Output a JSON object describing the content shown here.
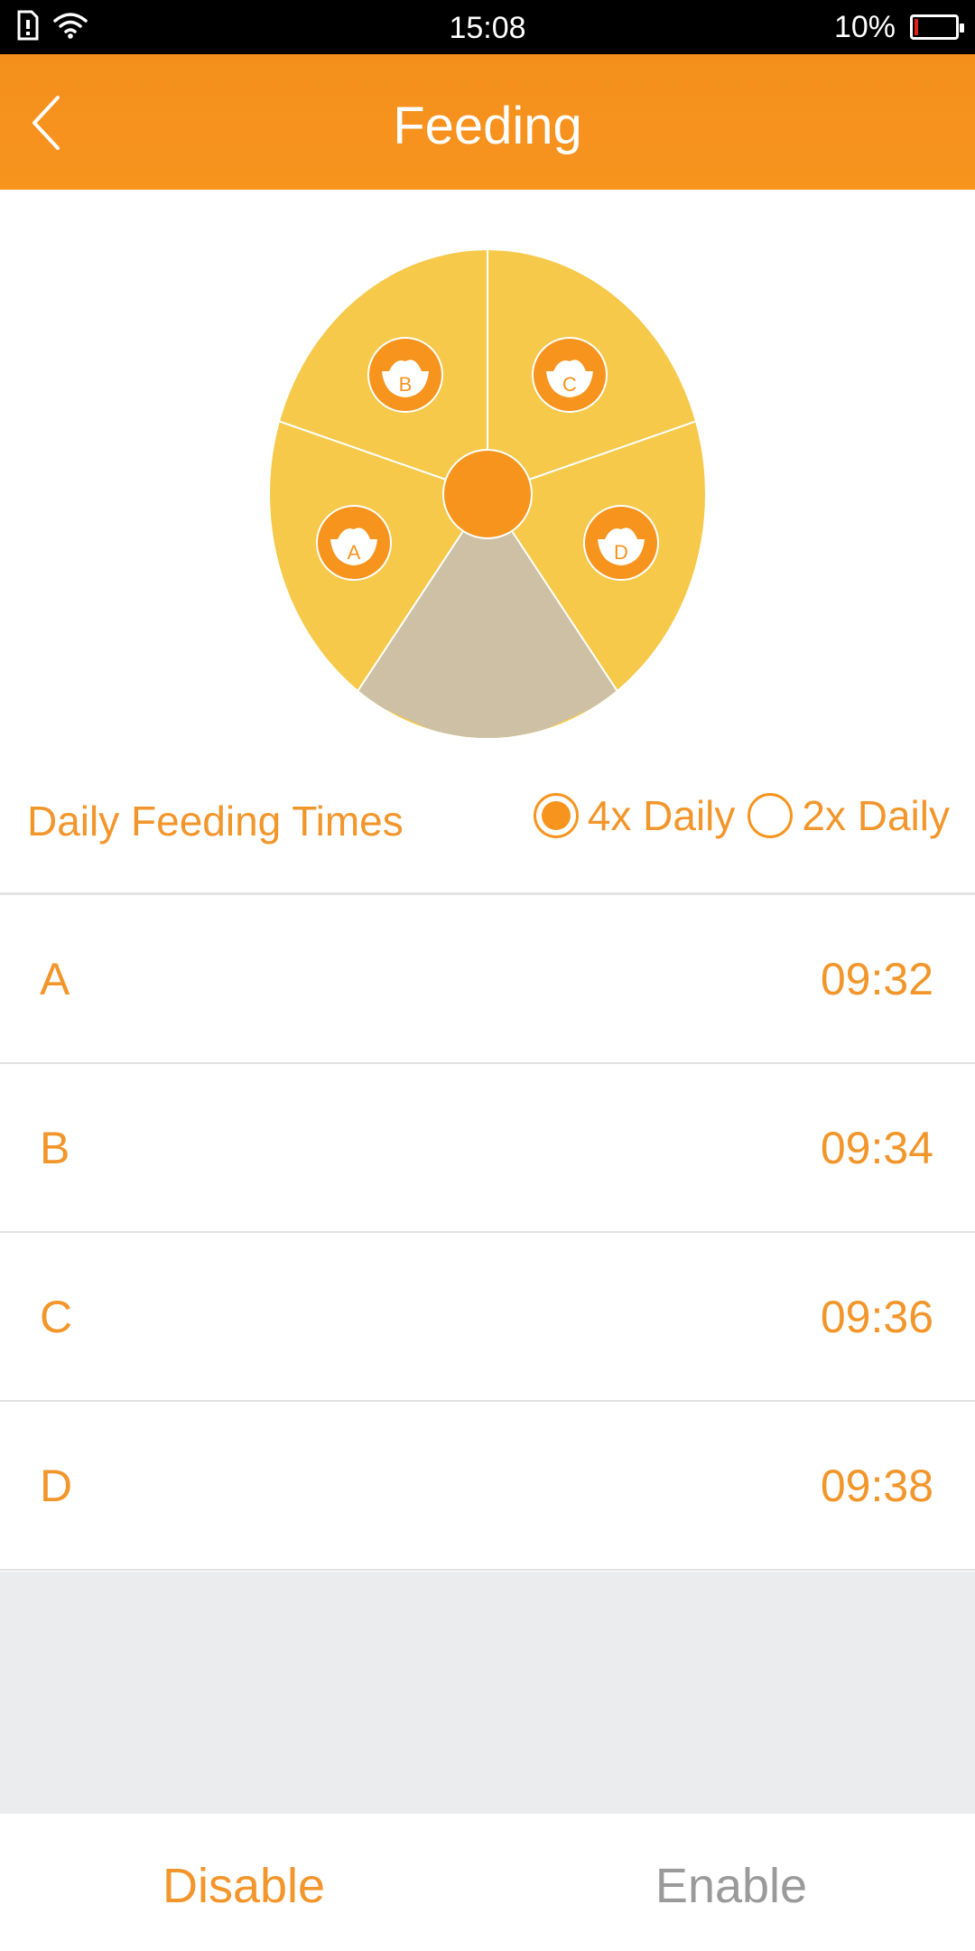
{
  "status_bar": {
    "time": "15:08",
    "battery_percent": "10%",
    "battery_level": 0.1,
    "icons": [
      "sim-card-icon",
      "wifi-icon",
      "battery-icon"
    ]
  },
  "header": {
    "title": "Feeding",
    "back_icon": "chevron-left-icon"
  },
  "wheel": {
    "compartments": [
      "A",
      "B",
      "C",
      "D"
    ],
    "colors": {
      "segment": "#f6c94b",
      "empty_segment": "#cdc0a4",
      "hub": "#f7941e",
      "bowl_badge": "#f7941e"
    }
  },
  "feeding_frequency": {
    "label": "Daily Feeding Times",
    "options": [
      {
        "label": "4x Daily",
        "selected": true
      },
      {
        "label": "2x Daily",
        "selected": false
      }
    ]
  },
  "schedule": [
    {
      "name": "A",
      "time": "09:32"
    },
    {
      "name": "B",
      "time": "09:34"
    },
    {
      "name": "C",
      "time": "09:36"
    },
    {
      "name": "D",
      "time": "09:38"
    }
  ],
  "footer": {
    "disable_label": "Disable",
    "enable_label": "Enable"
  },
  "theme": {
    "accent": "#f7941e",
    "text_accent": "#f2962b",
    "inactive_text": "#9a9a9a",
    "background_gray": "#ebecee"
  }
}
